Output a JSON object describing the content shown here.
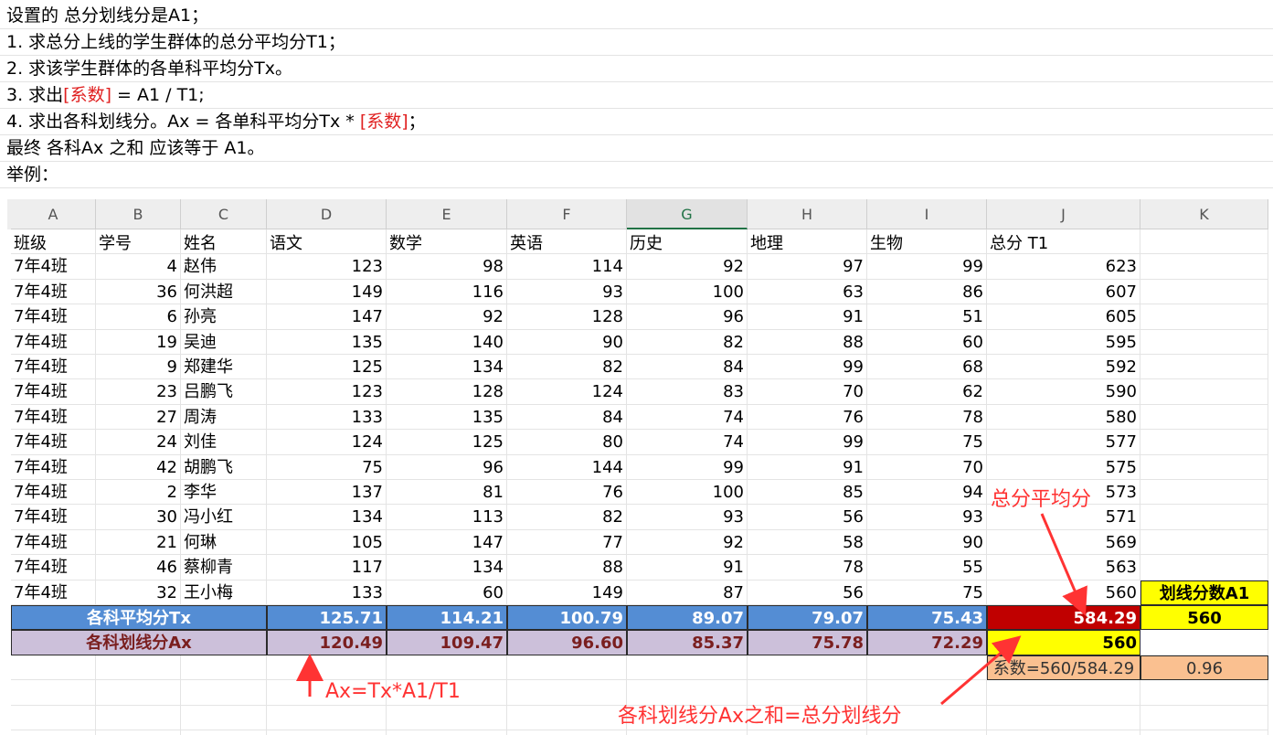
{
  "notes": {
    "line1": "设置的 总分划线分是A1；",
    "line2": "1. 求总分上线的学生群体的总分平均分T1；",
    "line3": "2. 求该学生群体的各单科平均分Tx。",
    "line4_a": "3. 求出",
    "line4_red": "[系数]",
    "line4_b": " = A1 / T1;",
    "line5_a": "4. 求出各科划线分。Ax = 各单科平均分Tx * ",
    "line5_red": "[系数]",
    "line5_b": "；",
    "line6": "最终 各科Ax 之和 应该等于 A1。",
    "line7": "举例："
  },
  "sheet": {
    "columns": [
      "A",
      "B",
      "C",
      "D",
      "E",
      "F",
      "G",
      "H",
      "I",
      "J",
      "K"
    ],
    "selected_column": "G",
    "headers": [
      "班级",
      "学号",
      "姓名",
      "语文",
      "数学",
      "英语",
      "历史",
      "地理",
      "生物",
      "总分 T1",
      ""
    ],
    "rows": [
      [
        "7年4班",
        "4",
        "赵伟",
        "123",
        "98",
        "114",
        "92",
        "97",
        "99",
        "623"
      ],
      [
        "7年4班",
        "36",
        "何洪超",
        "149",
        "116",
        "93",
        "100",
        "63",
        "86",
        "607"
      ],
      [
        "7年4班",
        "6",
        "孙亮",
        "147",
        "92",
        "128",
        "96",
        "91",
        "51",
        "605"
      ],
      [
        "7年4班",
        "19",
        "吴迪",
        "135",
        "140",
        "90",
        "82",
        "88",
        "60",
        "595"
      ],
      [
        "7年4班",
        "9",
        "郑建华",
        "125",
        "134",
        "82",
        "84",
        "99",
        "68",
        "592"
      ],
      [
        "7年4班",
        "23",
        "吕鹏飞",
        "123",
        "128",
        "124",
        "83",
        "70",
        "62",
        "590"
      ],
      [
        "7年4班",
        "27",
        "周涛",
        "133",
        "135",
        "84",
        "74",
        "76",
        "78",
        "580"
      ],
      [
        "7年4班",
        "24",
        "刘佳",
        "124",
        "125",
        "80",
        "74",
        "99",
        "75",
        "577"
      ],
      [
        "7年4班",
        "42",
        "胡鹏飞",
        "75",
        "96",
        "144",
        "99",
        "91",
        "70",
        "575"
      ],
      [
        "7年4班",
        "2",
        "李华",
        "137",
        "81",
        "76",
        "100",
        "85",
        "94",
        "573"
      ],
      [
        "7年4班",
        "30",
        "冯小红",
        "134",
        "113",
        "82",
        "93",
        "56",
        "93",
        "571"
      ],
      [
        "7年4班",
        "21",
        "何琳",
        "105",
        "147",
        "77",
        "92",
        "58",
        "90",
        "569"
      ],
      [
        "7年4班",
        "46",
        "蔡柳青",
        "117",
        "134",
        "88",
        "91",
        "78",
        "55",
        "563"
      ],
      [
        "7年4班",
        "32",
        "王小梅",
        "133",
        "60",
        "149",
        "87",
        "56",
        "75",
        "560"
      ]
    ],
    "a1_label": "划线分数A1",
    "avg_row": {
      "label": "各科平均分Tx",
      "values": [
        "125.71",
        "114.21",
        "100.79",
        "89.07",
        "79.07",
        "75.43"
      ],
      "total": "584.29",
      "a1": "560"
    },
    "line_row": {
      "label": "各科划线分Ax",
      "values": [
        "120.49",
        "109.47",
        "96.60",
        "85.37",
        "75.78",
        "72.29"
      ],
      "total": "560"
    },
    "coef_row": {
      "formula": "系数=560/584.29",
      "value": "0.96"
    }
  },
  "annotations": {
    "avg_total": "总分平均分",
    "formula": "Ax=Tx*A1/T1",
    "sum_note": "各科划线分Ax之和=总分划线分"
  },
  "colors": {
    "accent_red": "#ff3333",
    "avg_row": "#548dd4",
    "line_row": "#ccc0da",
    "total_avg": "#c00000",
    "highlight": "#ffff00",
    "coefficient": "#fac090"
  }
}
